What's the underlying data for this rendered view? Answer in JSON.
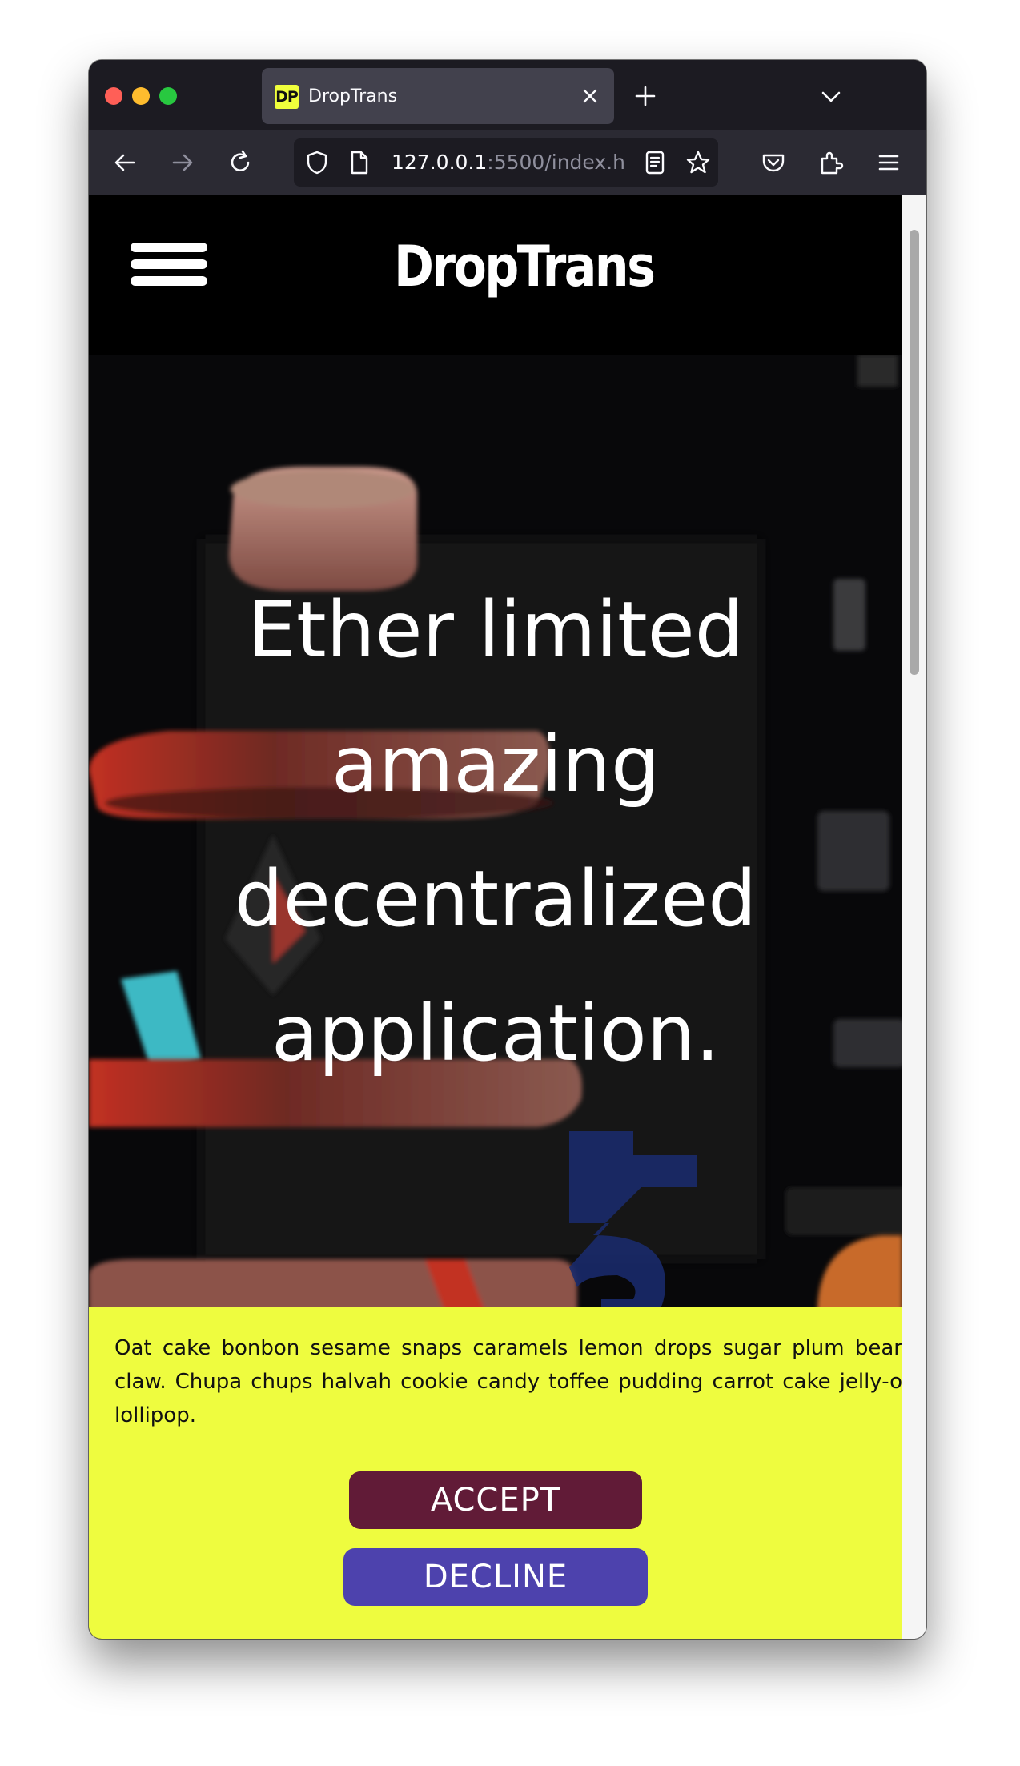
{
  "browser": {
    "tab": {
      "title": "DropTrans",
      "favicon_text": "DP"
    },
    "url": {
      "host": "127.0.0.1",
      "rest": ":5500/index.h"
    },
    "icons": [
      "back-arrow-icon",
      "forward-arrow-icon",
      "reload-icon",
      "shield-icon",
      "page-icon",
      "reader-view-icon",
      "bookmark-star-icon",
      "pocket-icon",
      "extensions-icon",
      "menu-icon",
      "close-icon",
      "plus-icon",
      "chevron-down-icon"
    ]
  },
  "site": {
    "logo": "DropTrans",
    "hero": {
      "lines": [
        "Ether limited",
        "amazing",
        "decentralized",
        "application."
      ]
    },
    "consent": {
      "text": "Oat cake bonbon sesame snaps caramels lemon drops sugar plum bear claw. Chupa chups halvah cookie candy toffee pudding carrot cake jelly-o lollipop.",
      "accept_label": "ACCEPT",
      "decline_label": "DECLINE"
    }
  },
  "colors": {
    "consent_bg": "#eefc3f",
    "accept_bg": "#611b37",
    "decline_bg": "#4d42ad",
    "chrome_dark": "#1c1b22",
    "toolbar": "#2b2a33"
  }
}
